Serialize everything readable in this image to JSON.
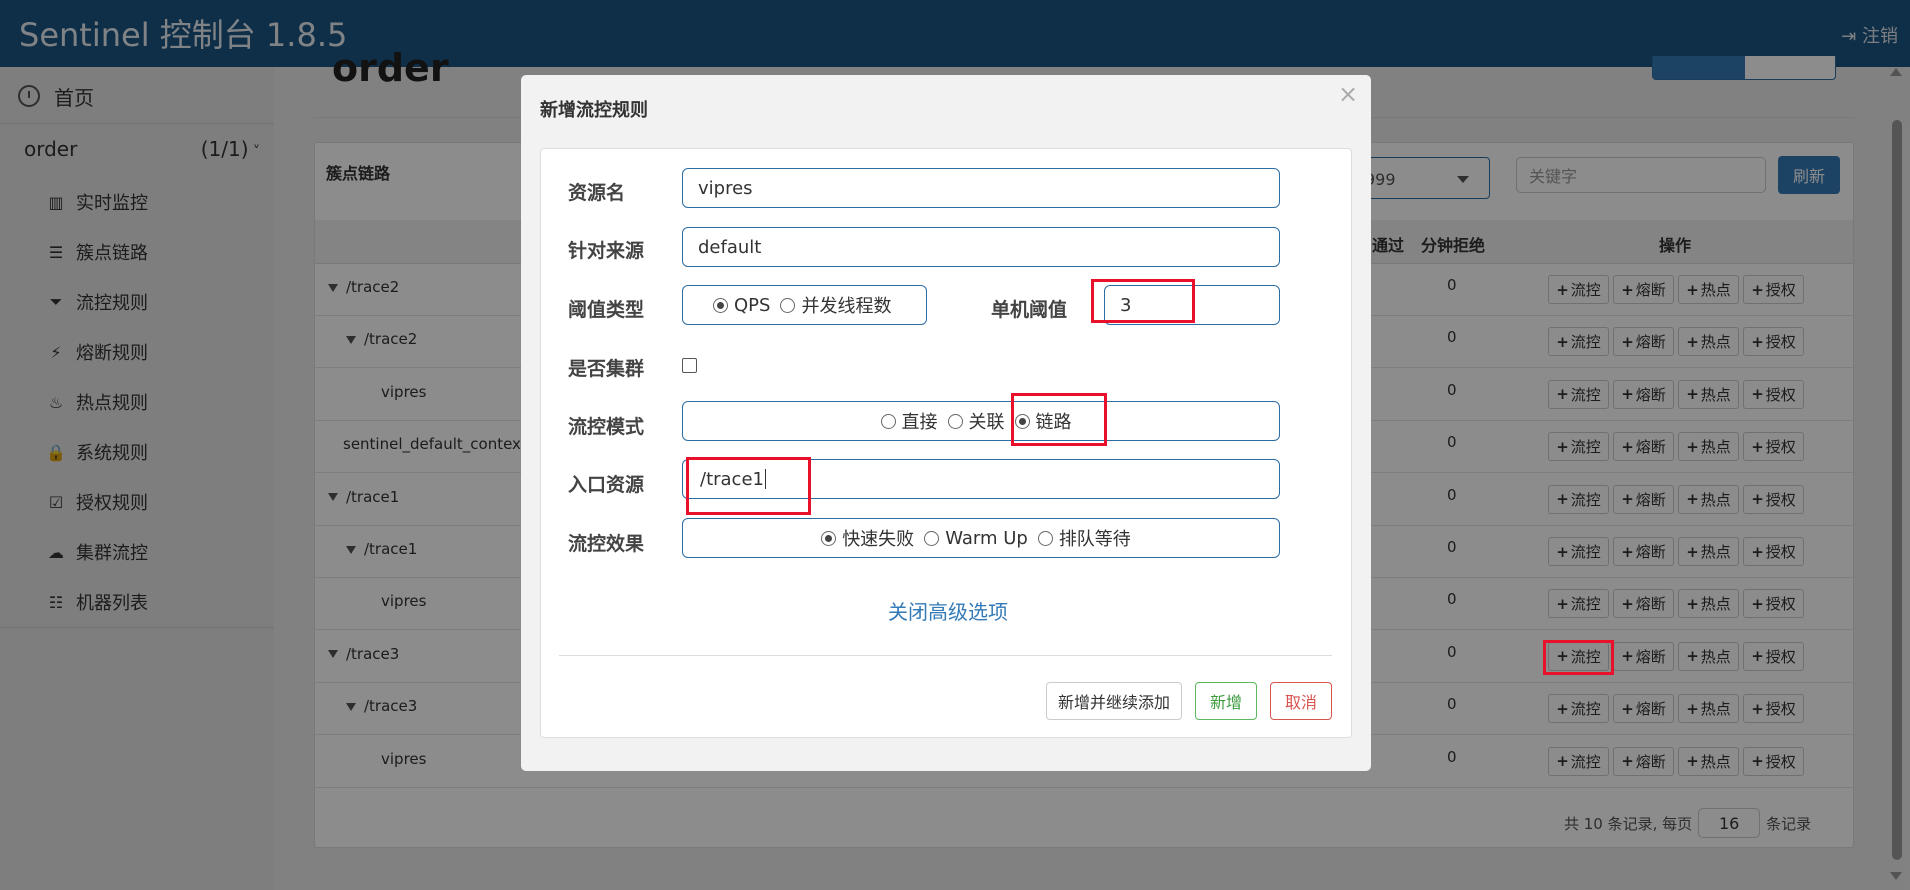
{
  "app": {
    "title": "Sentinel 控制台 1.8.5",
    "logout": "注销"
  },
  "sidebar": {
    "home": "首页",
    "app_name": "order",
    "app_count": "(1/1)",
    "items": [
      {
        "label": "实时监控",
        "icon": "bar-chart-icon",
        "glyph": "▥"
      },
      {
        "label": "簇点链路",
        "icon": "list-icon",
        "glyph": "☰"
      },
      {
        "label": "流控规则",
        "icon": "filter-icon",
        "glyph": "⏷"
      },
      {
        "label": "熔断规则",
        "icon": "bolt-icon",
        "glyph": "⚡"
      },
      {
        "label": "热点规则",
        "icon": "fire-icon",
        "glyph": "♨"
      },
      {
        "label": "系统规则",
        "icon": "lock-icon",
        "glyph": "🔒"
      },
      {
        "label": "授权规则",
        "icon": "check-square-icon",
        "glyph": "☑"
      },
      {
        "label": "集群流控",
        "icon": "cloud-icon",
        "glyph": "☁"
      },
      {
        "label": "机器列表",
        "icon": "th-list-icon",
        "glyph": "☷"
      }
    ]
  },
  "main": {
    "title": "order",
    "panel_title": "簇点链路",
    "machine_select": "999",
    "keyword_placeholder": "关键字",
    "refresh": "刷新",
    "headers": {
      "pass": "通过",
      "reject": "分钟拒绝",
      "ops": "操作"
    },
    "rows": [
      {
        "name": "/trace2",
        "level": 0,
        "expand": true,
        "reject": "0"
      },
      {
        "name": "/trace2",
        "level": 1,
        "expand": true,
        "reject": "0"
      },
      {
        "name": "vipres",
        "level": 2,
        "expand": false,
        "reject": "0"
      },
      {
        "name": "sentinel_default_context",
        "level": 0,
        "expand": false,
        "reject": "0"
      },
      {
        "name": "/trace1",
        "level": 0,
        "expand": true,
        "reject": "0"
      },
      {
        "name": "/trace1",
        "level": 1,
        "expand": true,
        "reject": "0"
      },
      {
        "name": "vipres",
        "level": 2,
        "expand": false,
        "reject": "0"
      },
      {
        "name": "/trace3",
        "level": 0,
        "expand": true,
        "reject": "0"
      },
      {
        "name": "/trace3",
        "level": 1,
        "expand": true,
        "reject": "0"
      },
      {
        "name": "vipres",
        "level": 2,
        "expand": false,
        "reject": "0"
      }
    ],
    "op_buttons": {
      "flow": "流控",
      "degrade": "熔断",
      "hot": "热点",
      "auth": "授权"
    },
    "pager": {
      "prefix": "共 10 条记录, 每页",
      "page_size": "16",
      "suffix": "条记录"
    }
  },
  "modal": {
    "title": "新增流控规则",
    "close": "×",
    "resource_label": "资源名",
    "resource_value": "vipres",
    "limit_app_label": "针对来源",
    "limit_app_value": "default",
    "grade_label": "阈值类型",
    "grade_options": [
      "QPS",
      "并发线程数"
    ],
    "grade_selected": "QPS",
    "count_label": "单机阈值",
    "count_value": "3",
    "cluster_label": "是否集群",
    "strategy_label": "流控模式",
    "strategy_options": [
      "直接",
      "关联",
      "链路"
    ],
    "strategy_selected": "链路",
    "ref_label": "入口资源",
    "ref_value": "/trace1",
    "effect_label": "流控效果",
    "effect_options": [
      "快速失败",
      "Warm Up",
      "排队等待"
    ],
    "effect_selected": "快速失败",
    "advanced_link": "关闭高级选项",
    "btn_add_continue": "新增并继续添加",
    "btn_add": "新增",
    "btn_cancel": "取消"
  }
}
